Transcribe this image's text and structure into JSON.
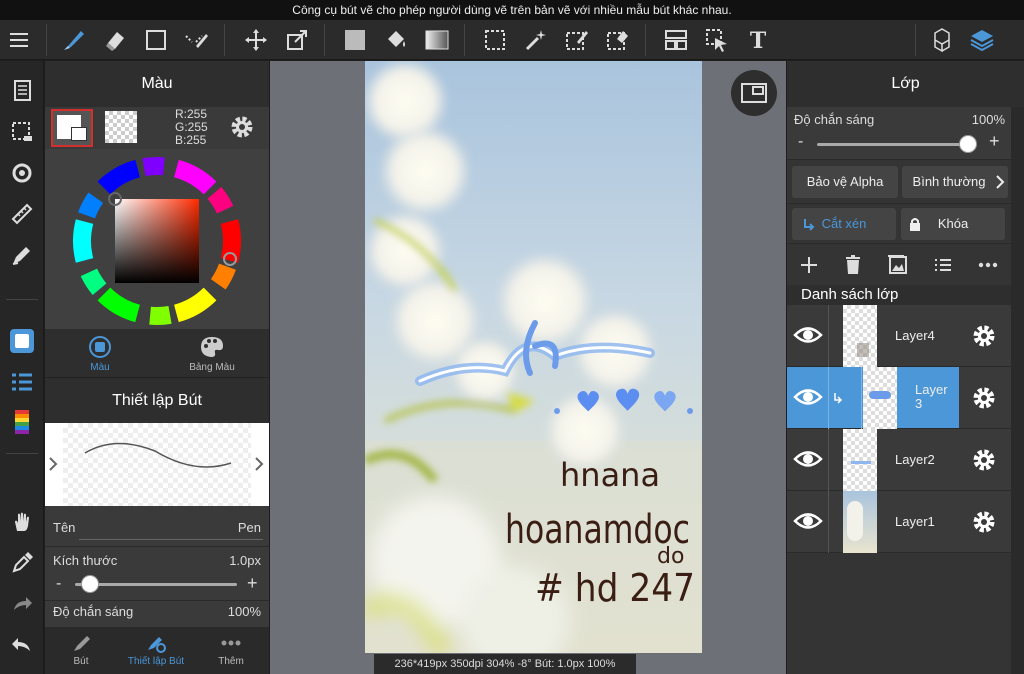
{
  "tooltip": "Công cụ bút vẽ cho phép người dùng vẽ trên bản vẽ với nhiều mẫu bút khác nhau.",
  "color_panel": {
    "title": "Màu",
    "rgb_r": "R:255",
    "rgb_g": "G:255",
    "rgb_b": "B:255",
    "tab_color": "Màu",
    "tab_palette": "Bảng Màu"
  },
  "brush_panel": {
    "title": "Thiết lập Bút",
    "name_label": "Tên",
    "name_value": "Pen",
    "size_label": "Kích thước",
    "size_value": "1.0px",
    "size_fraction": 0.03,
    "opacity_label": "Độ chắn sáng",
    "opacity_value": "100%"
  },
  "bottom_tabs": {
    "brush": "Bút",
    "brush_settings": "Thiết lập Bút",
    "more": "Thêm"
  },
  "canvas": {
    "status": "236*419px 350dpi 304% -8° Bút: 1.0px 100%",
    "text_line1": "hnana",
    "text_line2": "hoanamdoc",
    "text_line2b": "do",
    "text_line3": "# hd 247"
  },
  "layer_panel": {
    "title": "Lớp",
    "opacity_label": "Độ chắn sáng",
    "opacity_value": "100%",
    "opacity_fraction": 1.0,
    "minus": "-",
    "plus": "+",
    "alpha_protect": "Bảo vệ Alpha",
    "blend_mode": "Bình thường",
    "clipping": "Cắt xén",
    "lock": "Khóa",
    "list_title": "Danh sách lớp",
    "layers": [
      {
        "name": "Layer4",
        "selected": false
      },
      {
        "name": "Layer\n3",
        "selected": true
      },
      {
        "name": "Layer2",
        "selected": false
      },
      {
        "name": "Layer1",
        "selected": false
      }
    ]
  },
  "colors": {
    "accent": "#4b97d8",
    "panel": "#343434",
    "canvas_bg": "#6e7077"
  }
}
